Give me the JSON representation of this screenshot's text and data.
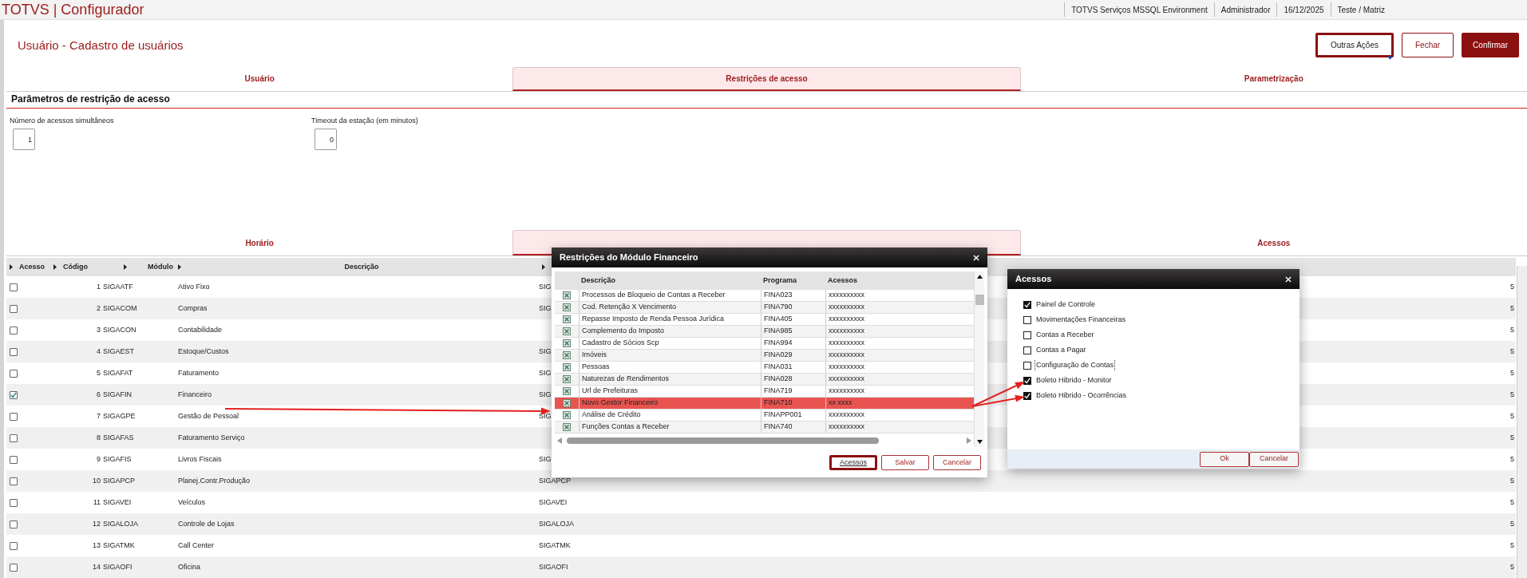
{
  "header": {
    "title": "TOTVS | Configurador",
    "info": [
      "TOTVS Serviços MSSQL Environment",
      "Administrador",
      "16/12/2025",
      "Teste / Matriz"
    ]
  },
  "page": {
    "title": "Usuário - Cadastro de usuários",
    "actions": [
      {
        "label": "Outras Ações",
        "kind": "menu"
      },
      {
        "label": "Fechar",
        "kind": "outline"
      },
      {
        "label": "Confirmar",
        "kind": "primary"
      }
    ]
  },
  "tabs": [
    {
      "label": "Usuário",
      "selected": false
    },
    {
      "label": "Restrições de acesso",
      "selected": true
    },
    {
      "label": "Parametrização",
      "selected": false
    }
  ],
  "section": {
    "title": "Parâmetros de restrição de acesso",
    "fields": [
      {
        "label": "Número de acessos simultâneos",
        "value": "1"
      },
      {
        "label": "Timeout da estação (em minutos)",
        "value": "0"
      }
    ]
  },
  "subtabs": [
    {
      "label": "Horário",
      "selected": false
    },
    {
      "selected": true
    },
    {
      "label": "Acessos",
      "selected": false
    }
  ],
  "table": {
    "columns": [
      "Acesso",
      "Código",
      "Módulo",
      "Descrição"
    ],
    "rows": [
      {
        "checked": false,
        "code": "1",
        "module": "SIGAATF",
        "description": "Ativo Fixo",
        "column_5": "SIG",
        "column_6": "5"
      },
      {
        "checked": false,
        "code": "2",
        "module": "SIGACOM",
        "description": "Compras",
        "column_5": "SIG",
        "column_6": "5"
      },
      {
        "checked": false,
        "code": "3",
        "module": "SIGACON",
        "description": "Contabilidade",
        "column_6": "5"
      },
      {
        "checked": false,
        "code": "4",
        "module": "SIGAEST",
        "description": "Estoque/Custos",
        "column_5": "SIG",
        "column_6": "5"
      },
      {
        "checked": false,
        "code": "5",
        "module": "SIGAFAT",
        "description": "Faturamento",
        "column_5": "SIG",
        "column_6": "5"
      },
      {
        "checked": true,
        "code": "6",
        "module": "SIGAFIN",
        "description": "Financeiro",
        "column_5": "SIG",
        "column_6": "5"
      },
      {
        "checked": false,
        "code": "7",
        "module": "SIGAGPE",
        "description": "Gestão de Pessoal",
        "column_5": "SIG",
        "column_6": "5"
      },
      {
        "checked": false,
        "code": "8",
        "module": "SIGAFAS",
        "description": "Faturamento Serviço",
        "column_6": "5"
      },
      {
        "checked": false,
        "code": "9",
        "module": "SIGAFIS",
        "description": "Livros Fiscais",
        "column_5": "SIG",
        "column_6": "5"
      },
      {
        "checked": false,
        "code": "10",
        "module": "SIGAPCP",
        "description": "Planej.Contr.Produção",
        "column_5": "SIGAPCP",
        "column_6": "5"
      },
      {
        "checked": false,
        "code": "11",
        "module": "SIGAVEI",
        "description": "Veículos",
        "column_5": "SIGAVEI",
        "column_6": "5"
      },
      {
        "checked": false,
        "code": "12",
        "module": "SIGALOJA",
        "description": "Controle de Lojas",
        "column_5": "SIGALOJA",
        "column_6": "5"
      },
      {
        "checked": false,
        "code": "13",
        "module": "SIGATMK",
        "description": "Call Center",
        "column_5": "SIGATMK",
        "column_6": "5"
      },
      {
        "checked": false,
        "code": "14",
        "module": "SIGAOFI",
        "description": "Oficina",
        "column_5": "SIGAOFI",
        "column_6": "5"
      }
    ]
  },
  "module_dialog": {
    "title": "Restrições do Módulo Financeiro",
    "columns": [
      "Descrição",
      "Programa",
      "Acessos"
    ],
    "rows": [
      {
        "description": "Processos de Bloqueio de Contas a Receber",
        "program": "FINA023",
        "access": "xxxxxxxxxx",
        "selected": false
      },
      {
        "description": "Cod. Retenção X Vencimento",
        "program": "FINA790",
        "access": "xxxxxxxxxx",
        "selected": false
      },
      {
        "description": "Repasse Imposto de Renda Pessoa Jurídica",
        "program": "FINA405",
        "access": "xxxxxxxxxx",
        "selected": false
      },
      {
        "description": "Complemento do Imposto",
        "program": "FINA985",
        "access": "xxxxxxxxxx",
        "selected": false
      },
      {
        "description": "Cadastro de Sócios Scp",
        "program": "FINA994",
        "access": "xxxxxxxxxx",
        "selected": false
      },
      {
        "description": "Imóveis",
        "program": "FINA029",
        "access": "xxxxxxxxxx",
        "selected": false
      },
      {
        "description": "Pessoas",
        "program": "FINA031",
        "access": "xxxxxxxxxx",
        "selected": false
      },
      {
        "description": "Naturezas de Rendimentos",
        "program": "FINA028",
        "access": "xxxxxxxxxx",
        "selected": false
      },
      {
        "description": "Url de Prefeituras",
        "program": "FINA719",
        "access": "xxxxxxxxxx",
        "selected": false
      },
      {
        "description": "Novo Gestor Financeiro",
        "program": "FINA710",
        "access": "xx xxxx",
        "selected": true
      },
      {
        "description": "Análise de Crédito",
        "program": "FINAPP001",
        "access": "xxxxxxxxxx",
        "selected": false
      },
      {
        "description": "Funções Contas a Receber",
        "program": "FINA740",
        "access": "xxxxxxxxxx",
        "selected": false
      }
    ],
    "buttons": [
      {
        "label": "Acessos",
        "focused": true
      },
      {
        "label": "Salvar",
        "focused": false
      },
      {
        "label": "Cancelar",
        "focused": false
      }
    ]
  },
  "access_dialog": {
    "title": "Acessos",
    "items": [
      {
        "label": "Painel de Controle",
        "checked": true,
        "focused": false
      },
      {
        "label": "Movimentações Financeiras",
        "checked": false,
        "focused": false
      },
      {
        "label": "Contas a Receber",
        "checked": false,
        "focused": false
      },
      {
        "label": "Contas a Pagar",
        "checked": false,
        "focused": false
      },
      {
        "label": "Configuração de Contas",
        "checked": false,
        "focused": true
      },
      {
        "label": "Boleto Hibrido - Monitor",
        "checked": true,
        "focused": false
      },
      {
        "label": "Boleto Hibrido - Ocorrências",
        "checked": true,
        "focused": false
      }
    ],
    "buttons": [
      "Ok",
      "Cancelar"
    ]
  }
}
